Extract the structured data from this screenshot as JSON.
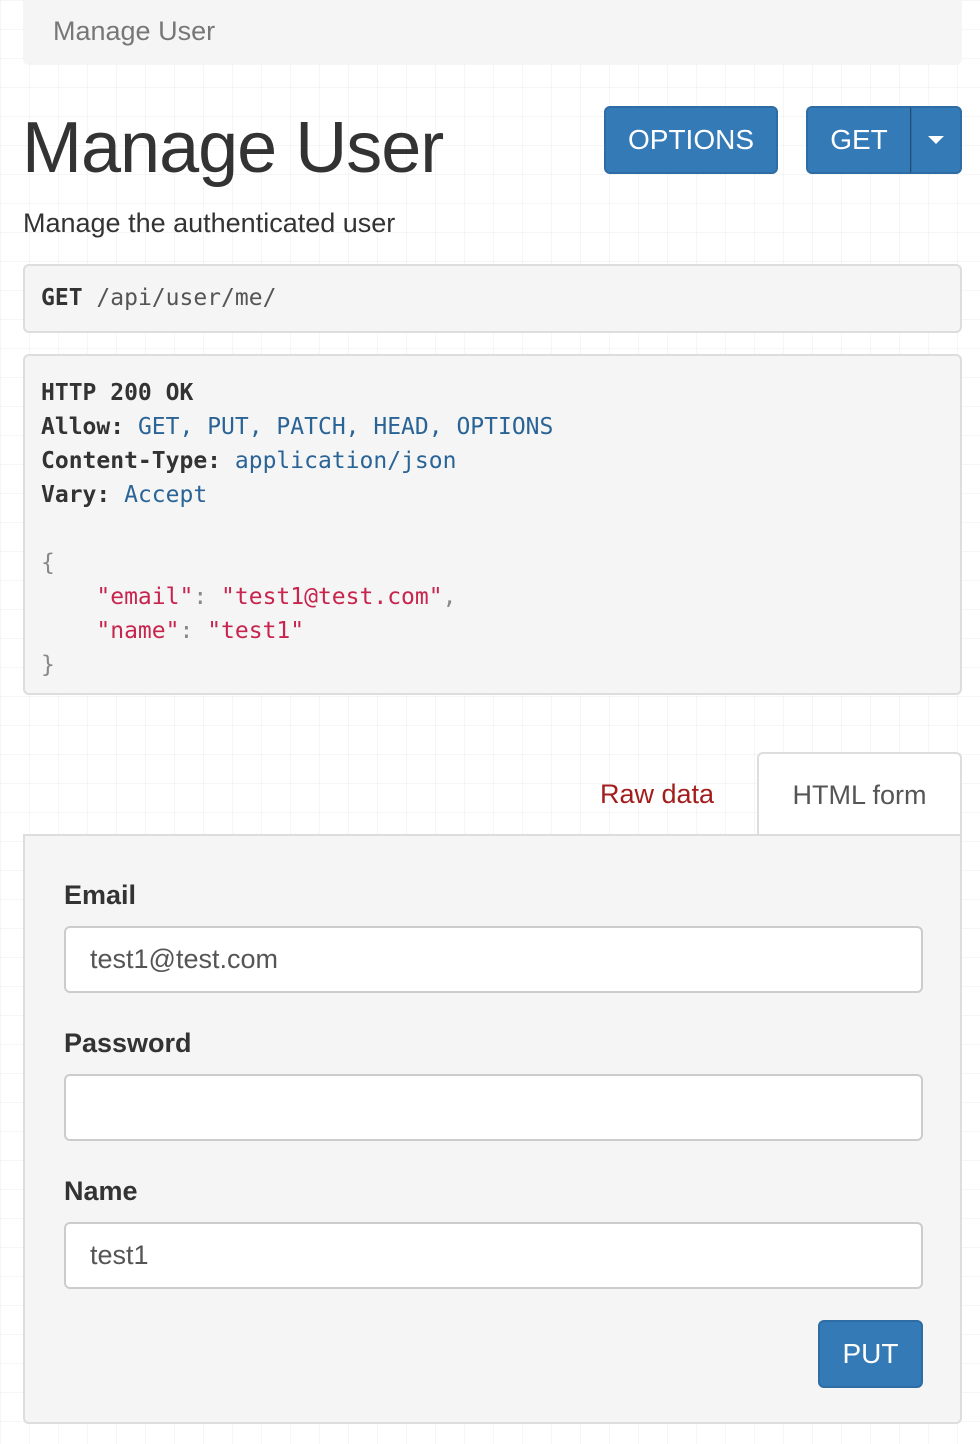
{
  "breadcrumb": {
    "label": "Manage User"
  },
  "header": {
    "title": "Manage User",
    "description": "Manage the authenticated user",
    "options_label": "OPTIONS",
    "get_label": "GET"
  },
  "request": {
    "method": "GET",
    "path": "/api/user/me/"
  },
  "response": {
    "status_line": "HTTP 200 OK",
    "headers": [
      {
        "name": "Allow:",
        "value": "GET, PUT, PATCH, HEAD, OPTIONS"
      },
      {
        "name": "Content-Type:",
        "value": "application/json"
      },
      {
        "name": "Vary:",
        "value": "Accept"
      }
    ],
    "body": {
      "open": "{",
      "close": "}",
      "email_key": "\"email\"",
      "email_value": "\"test1@test.com\"",
      "name_key": "\"name\"",
      "name_value": "\"test1\""
    }
  },
  "tabs": {
    "raw": "Raw data",
    "html": "HTML form"
  },
  "form": {
    "email_label": "Email",
    "email_value": "test1@test.com",
    "password_label": "Password",
    "password_value": "",
    "name_label": "Name",
    "name_value": "test1",
    "submit_label": "PUT"
  },
  "colors": {
    "primary": "#337ab7",
    "link_red": "#a31d1d",
    "string_red": "#c7254e",
    "header_value_blue": "#2a6496"
  }
}
